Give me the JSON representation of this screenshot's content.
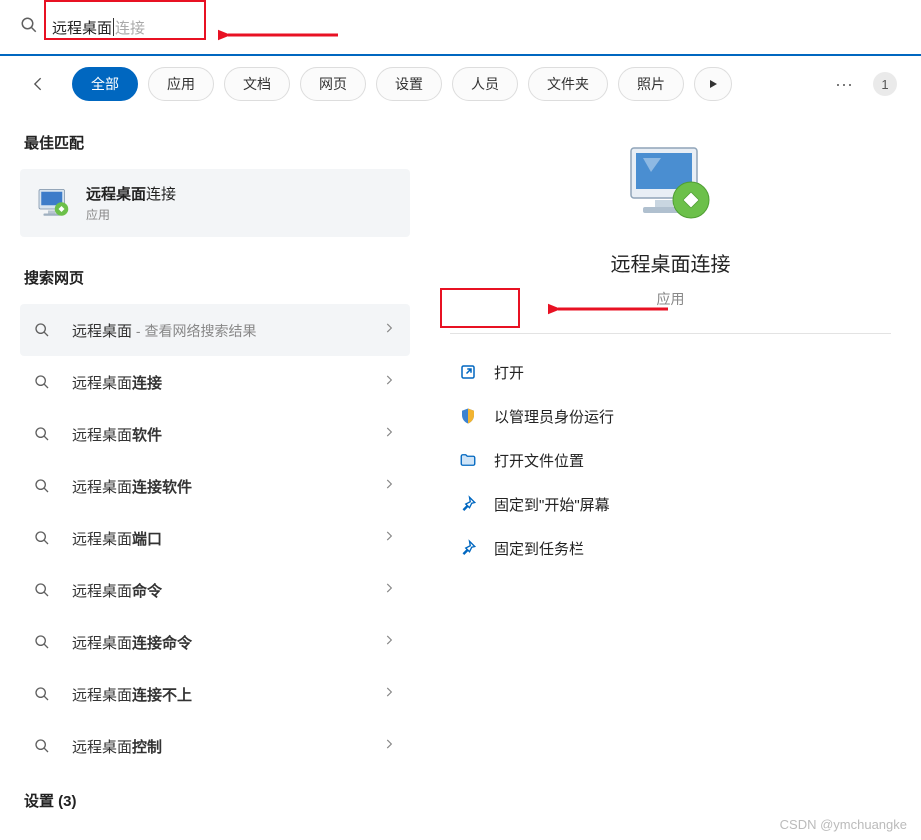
{
  "search": {
    "typed_prefix": "远程桌面",
    "suggestion_suffix": "连接"
  },
  "filters": {
    "all": "全部",
    "apps": "应用",
    "docs": "文档",
    "web": "网页",
    "settings": "设置",
    "people": "人员",
    "folders": "文件夹",
    "photos": "照片",
    "count": "1"
  },
  "left": {
    "best_match": "最佳匹配",
    "app_name_bold": "远程桌面",
    "app_name_rest": "连接",
    "app_type": "应用",
    "web_header": "搜索网页",
    "items": [
      {
        "prefix": "远程桌面",
        "bold": "",
        "hint": " - 查看网络搜索结果",
        "first": true
      },
      {
        "prefix": "远程桌面",
        "bold": "连接",
        "hint": ""
      },
      {
        "prefix": "远程桌面",
        "bold": "软件",
        "hint": ""
      },
      {
        "prefix": "远程桌面",
        "bold": "连接软件",
        "hint": ""
      },
      {
        "prefix": "远程桌面",
        "bold": "端口",
        "hint": ""
      },
      {
        "prefix": "远程桌面",
        "bold": "命令",
        "hint": ""
      },
      {
        "prefix": "远程桌面",
        "bold": "连接命令",
        "hint": ""
      },
      {
        "prefix": "远程桌面",
        "bold": "连接不上",
        "hint": ""
      },
      {
        "prefix": "远程桌面",
        "bold": "控制",
        "hint": ""
      }
    ],
    "settings_head": "设置 (3)"
  },
  "right": {
    "title": "远程桌面连接",
    "sub": "应用",
    "actions": {
      "open": "打开",
      "admin": "以管理员身份运行",
      "location": "打开文件位置",
      "pin_start": "固定到\"开始\"屏幕",
      "pin_task": "固定到任务栏"
    }
  },
  "watermark": "CSDN @ymchuangke"
}
